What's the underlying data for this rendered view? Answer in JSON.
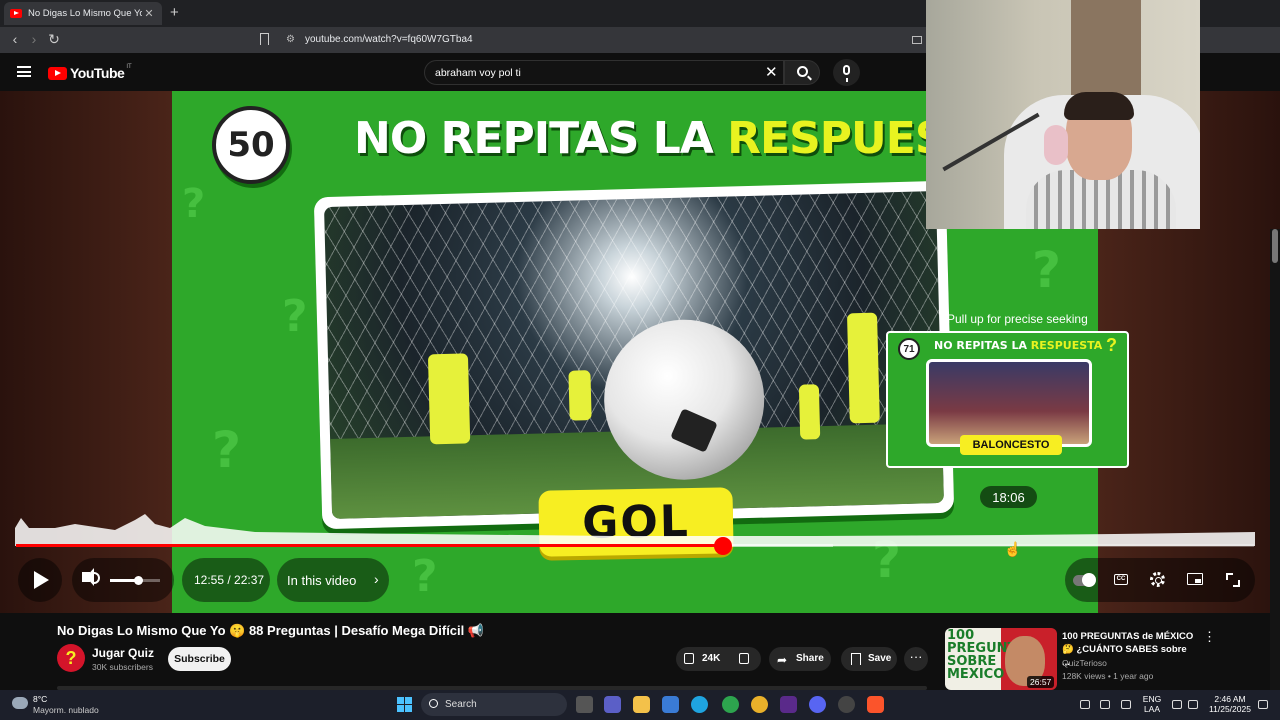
{
  "browser": {
    "tab_title": "No Digas Lo Mismo Que Yo 🤫",
    "tab_close": "✕",
    "new_tab": "+",
    "url": "youtube.com/watch?v=fq60W7GTba4"
  },
  "youtube": {
    "logo_text": "YouTube",
    "country_code": "IT",
    "search_value": "abraham  voy pol ti",
    "clear_glyph": "✕"
  },
  "video_frame": {
    "badge_number": "50",
    "title_white": "NO REPITAS LA ",
    "title_yellow": "RESPUESTA",
    "answer_label": "GOL"
  },
  "preview": {
    "hint": "Pull up for precise seeking",
    "badge_number": "71",
    "title_white": "NO REPITAS LA ",
    "title_yellow": "RESPUESTA",
    "question_mark": "?",
    "label": "BALONCESTO",
    "time": "18:06"
  },
  "player": {
    "current_time": "12:55 / 22:37",
    "chapter_label": "In this video",
    "chapter_chevron": "›",
    "progress_fraction": 0.571,
    "buffer_fraction": 0.66,
    "volume_fraction": 0.55,
    "cc_label": "CC"
  },
  "video_info": {
    "title": "No Digas Lo Mismo Que Yo 🤫 88 Preguntas | Desafío Mega Difícil 📢",
    "channel_name": "Jugar Quiz",
    "channel_avatar": "?",
    "subscribers": "30K subscribers",
    "subscribe_label": "Subscribe",
    "like_count": "24K",
    "share_label": "Share",
    "save_label": "Save",
    "more_label": "···"
  },
  "recommendation": {
    "thumb_text_line1": "100",
    "thumb_text_line2": "PREGUNTAS",
    "thumb_text_line3": "SOBRE",
    "thumb_text_line4": "MEXICO",
    "duration": "26:57",
    "title": "100 PREGUNTAS de MÉXICO 🤔 ¿CUÁNTO SABES sobre ...",
    "channel": "QuizTerioso",
    "meta": "128K views • 1 year ago",
    "more_label": "⋮"
  },
  "taskbar": {
    "temperature": "8°C",
    "weather_desc": "Mayorm. nublado",
    "search_label": "Search",
    "lang_line1": "ENG",
    "lang_line2": "LAA",
    "clock_time": "2:46 AM",
    "clock_date": "11/25/2025",
    "colors": {
      "windows_blue": "#4cc2ff",
      "youtube_red": "#ff0000",
      "video_green": "#2ea82a",
      "title_yellow": "#e8f320"
    }
  }
}
